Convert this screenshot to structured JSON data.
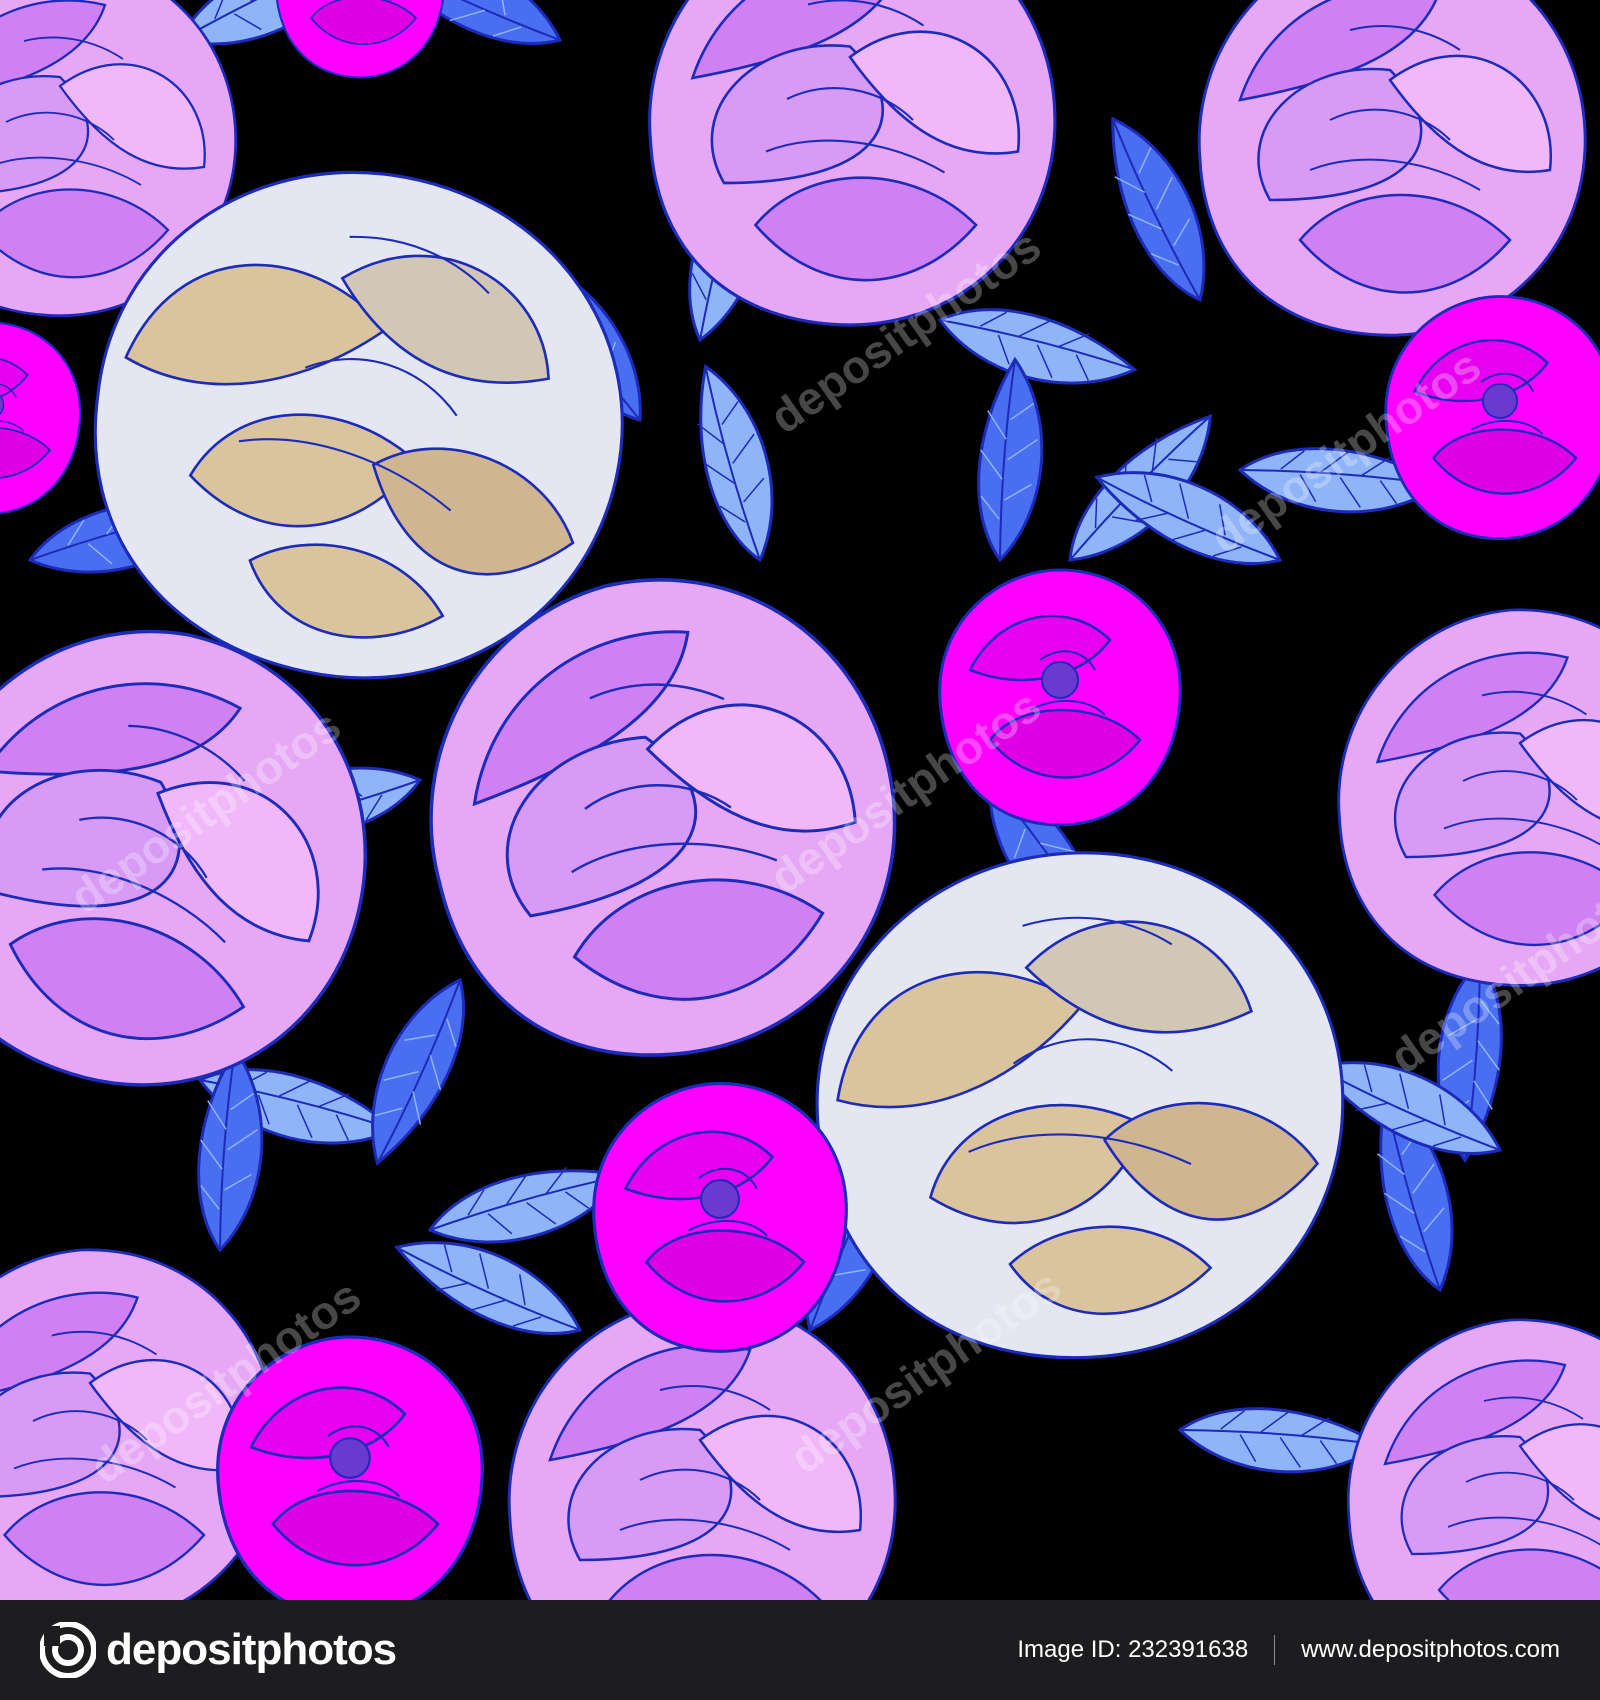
{
  "image": {
    "description_colors": {
      "background": "#000000",
      "pink_petal_light": "#e6a8f5",
      "pink_petal_mid": "#cf80f2",
      "magenta_bud": "#ff00ff",
      "beige_petal": "#d9c49e",
      "pale_petal": "#e4e6f2",
      "leaf_light": "#8fb4f7",
      "leaf_dark": "#4a6ef0",
      "outline": "#1c2bb8"
    },
    "watermark_text": "depositphotos"
  },
  "footer": {
    "brand_name": "depositphotos",
    "brand_icon": "depositphotos-logo-icon",
    "image_id_label": "Image ID: 232391638",
    "website": "www.depositphotos.com",
    "background_color": "#1d1d1f"
  }
}
